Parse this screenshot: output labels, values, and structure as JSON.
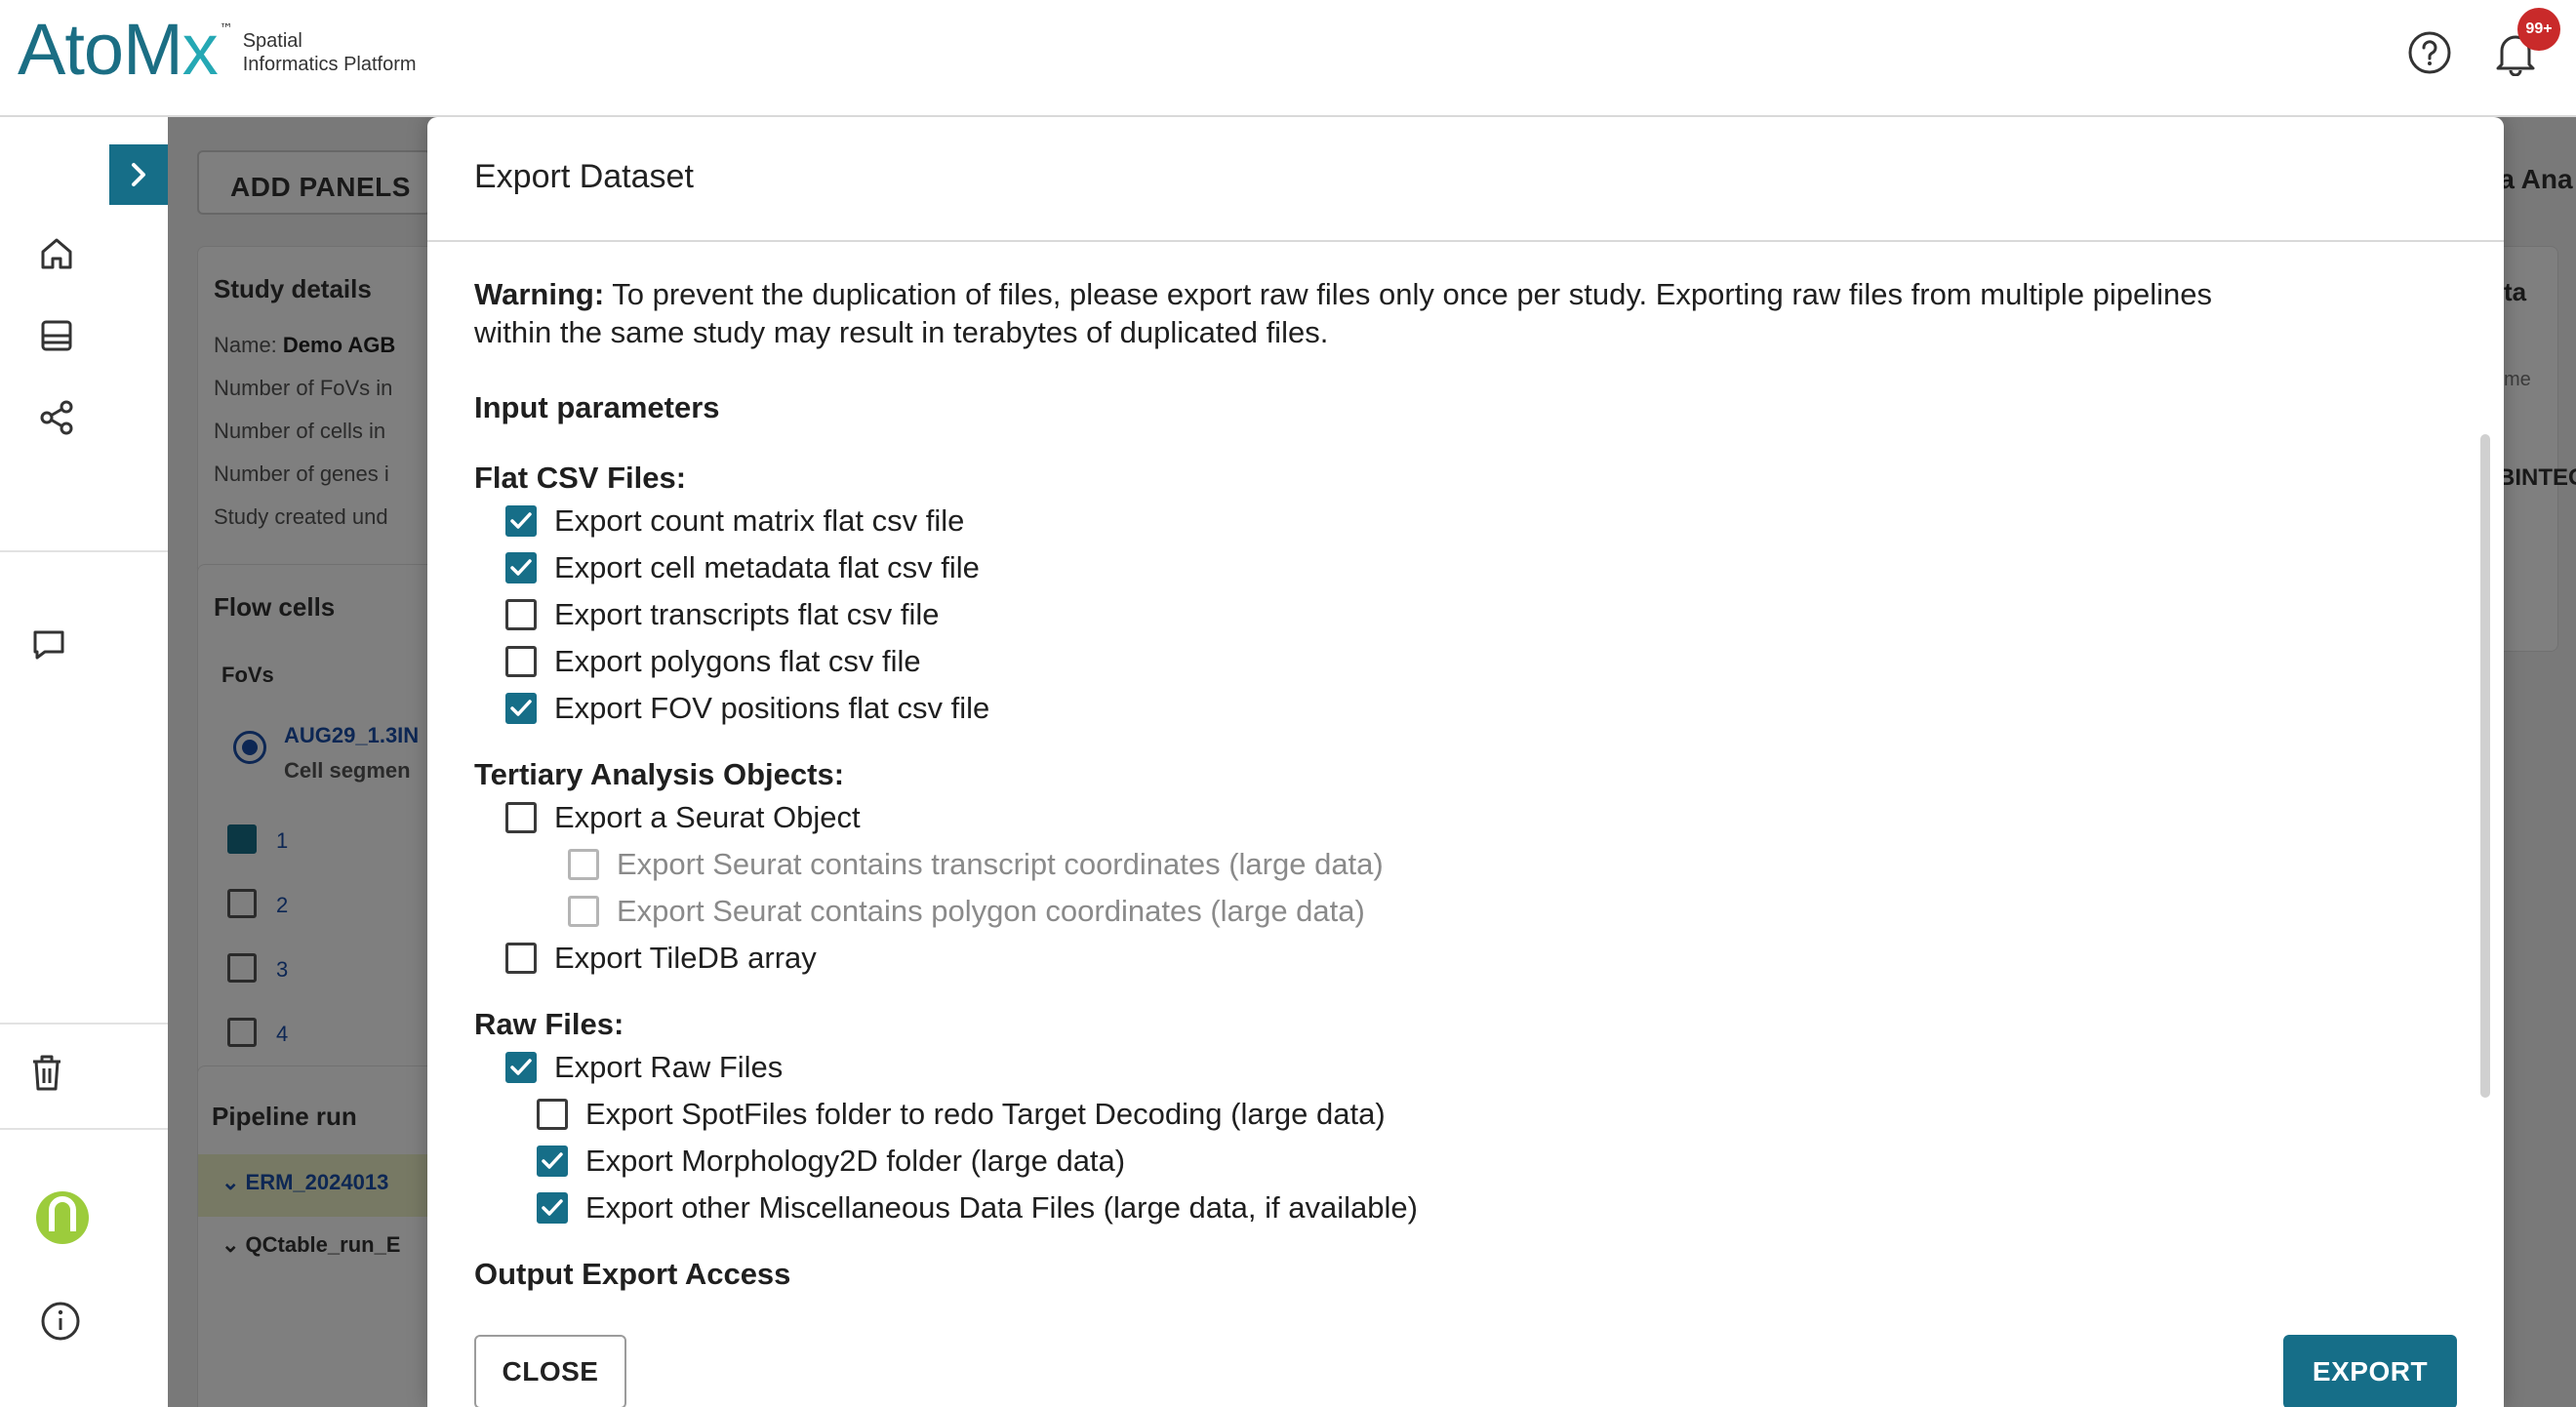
{
  "app": {
    "logo_text_1": "AtoM",
    "logo_text_2": "x",
    "logo_tm": "™",
    "logo_sub_1": "Spatial",
    "logo_sub_2": "Informatics Platform",
    "notification_count": "99+"
  },
  "colors": {
    "accent": "#166e88",
    "badge": "#c92a2a",
    "logo": "#1b6e84"
  },
  "background": {
    "add_panels": "ADD PANELS",
    "study_details": {
      "title": "Study details",
      "name_label": "Name:",
      "name_value": "Demo AGB",
      "fovs_line": "Number of FoVs in",
      "cells_line": "Number of cells in",
      "genes_line": "Number of genes i",
      "created_line": "Study created und"
    },
    "flow_cells": {
      "title": "Flow cells",
      "fovs_header": "FoVs",
      "run_name": "AUG29_1.3IN",
      "run_sub": "Cell segmen",
      "rows": [
        "1",
        "2",
        "3",
        "4"
      ]
    },
    "pipeline": {
      "title": "Pipeline run",
      "row1": "ERM_2024013",
      "row2": "QCtable_run_E"
    },
    "right_peek": {
      "t1": "ta Ana",
      "t2": "ta",
      "t3": "me",
      "t4": "BINTEG"
    }
  },
  "modal": {
    "title": "Export Dataset",
    "warning_label": "Warning:",
    "warning_line1": "To prevent the duplication of files, please export raw files only once per study. Exporting raw files from multiple pipelines",
    "warning_line2": "within the same study may result in terabytes of duplicated files.",
    "input_parameters": "Input parameters",
    "flat_csv": {
      "title": "Flat CSV Files:",
      "options": [
        {
          "label": "Export count matrix flat csv file",
          "checked": true
        },
        {
          "label": "Export cell metadata flat csv file",
          "checked": true
        },
        {
          "label": "Export transcripts flat csv file",
          "checked": false
        },
        {
          "label": "Export polygons flat csv file",
          "checked": false
        },
        {
          "label": "Export FOV positions flat csv file",
          "checked": true
        }
      ]
    },
    "tertiary": {
      "title": "Tertiary Analysis Objects:",
      "seurat": "Export a Seurat Object",
      "seurat_transcripts": "Export Seurat contains transcript coordinates (large data)",
      "seurat_polygons": "Export Seurat contains polygon coordinates (large data)",
      "tiledb": "Export TileDB array"
    },
    "raw": {
      "title": "Raw Files:",
      "raw_files": "Export Raw Files",
      "spotfiles": "Export SpotFiles folder to redo Target Decoding (large data)",
      "morphology": "Export Morphology2D folder (large data)",
      "misc": "Export other Miscellaneous Data Files (large data, if available)"
    },
    "output_access": "Output Export Access",
    "close": "CLOSE",
    "export": "EXPORT"
  }
}
